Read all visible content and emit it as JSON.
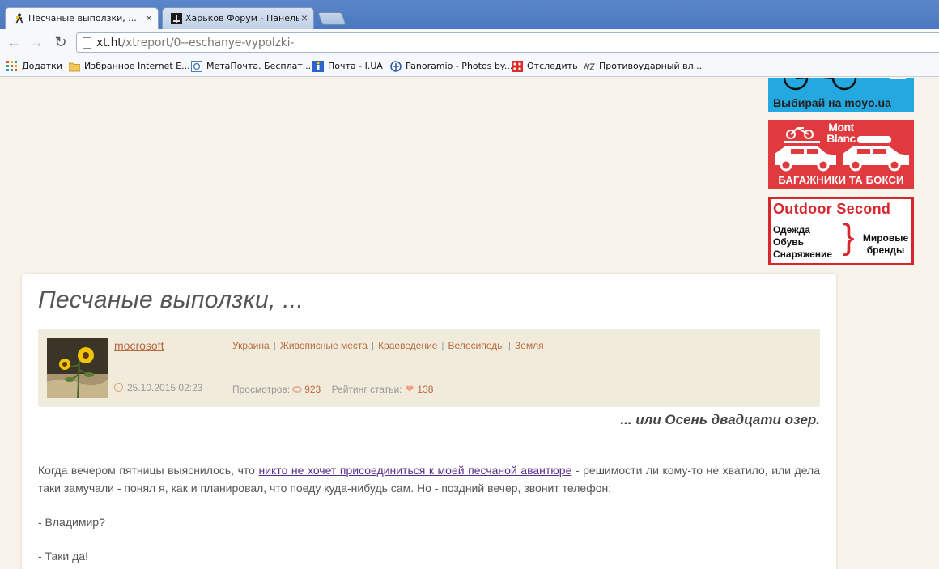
{
  "browser": {
    "tabs": [
      {
        "title": "Песчаные выползки, ...",
        "active": true
      },
      {
        "title": "Харьков Форум - Панель к...",
        "active": false
      }
    ],
    "tab_close": "×",
    "address": {
      "host": "xt.ht",
      "path": "/xtreport/0--eschanye-vypolzki-"
    },
    "bookmarks": [
      {
        "label": "Додатки",
        "icon": "apps-icon"
      },
      {
        "label": "Избранное Internet E...",
        "icon": "folder-icon"
      },
      {
        "label": "МетаПочта. Бесплат...",
        "icon": "metapochta-icon"
      },
      {
        "label": "Почта - I.UA",
        "icon": "iua-icon"
      },
      {
        "label": "Panoramio - Photos by...",
        "icon": "panoramio-icon"
      },
      {
        "label": "Отследить",
        "icon": "track-icon"
      },
      {
        "label": "Противоударный вл...",
        "icon": "mz-icon"
      }
    ]
  },
  "ads": {
    "moyo": {
      "label": "Выбирай на moyo.ua"
    },
    "montblanc": {
      "brand_line1": "Mont",
      "brand_line2": "Blanc",
      "label": "БАГАЖНИКИ ТА БОКСИ"
    },
    "outdoor": {
      "title": "Outdoor Second",
      "items": [
        "Одежда",
        "Обувь",
        "Снаряжение"
      ],
      "right_line1": "Мировые",
      "right_line2": "бренды",
      "brace": "}"
    }
  },
  "article": {
    "title": "Песчаные выползки, ...",
    "author": "mocrosoft",
    "date": "25.10.2015 02:23",
    "tags": [
      "Украина",
      "Живописные места",
      "Краеведение",
      "Велосипеды",
      "Земля"
    ],
    "views_label": "Просмотров:",
    "views": "923",
    "rating_label": "Рейтинг статьи:",
    "rating": "138",
    "subtitle": "... или Осень двадцати озер.",
    "para1_before": "Когда вечером пятницы выяснилось, что ",
    "para1_link": "никто не хочет присоединиться к моей песчаной авантюре",
    "para1_after": " - решимости ли кому-то не хватило, или дела таки замучали - понял я, как и планировал, что поеду куда-нибудь сам. Но - поздний вечер, звонит телефон:",
    "para2": "- Владимир?",
    "para3": "- Таки да!"
  },
  "colors": {
    "accent": "#b86a3e",
    "link_visited": "#5a2e8c",
    "moyo_bg": "#23a8e0",
    "montblanc_bg": "#e03a3e",
    "outdoor_red": "#d7262c"
  }
}
